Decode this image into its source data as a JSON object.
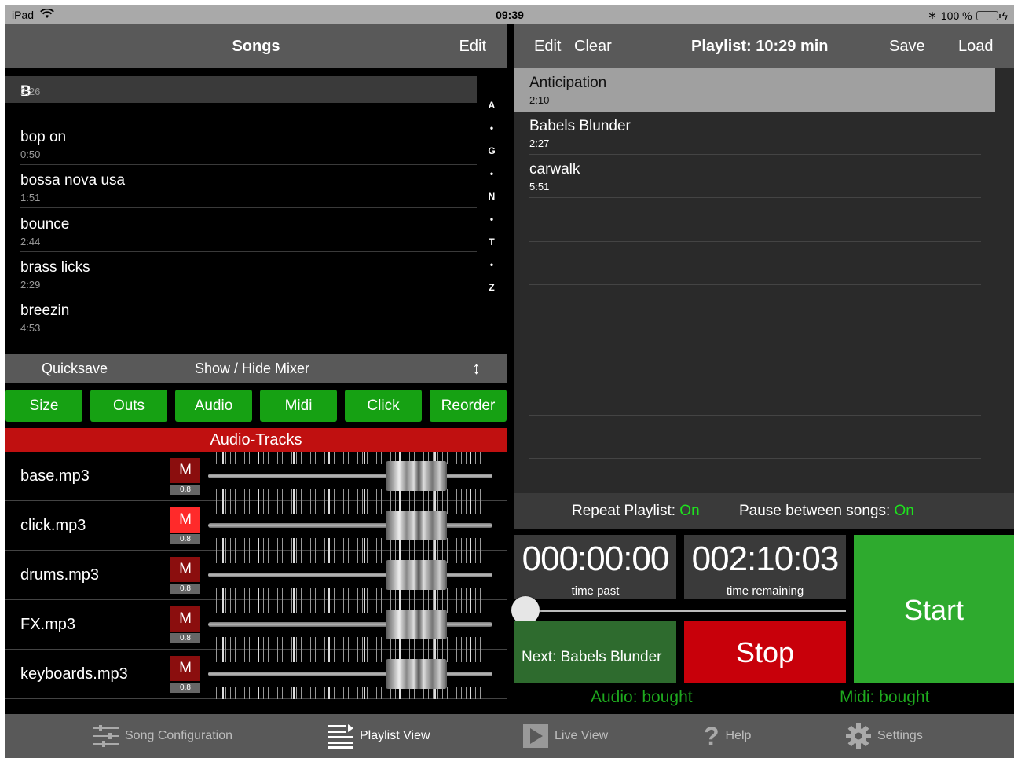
{
  "status_bar": {
    "device": "iPad",
    "time": "09:39",
    "battery": "100 %",
    "battery_level": 1.0
  },
  "songs_panel": {
    "title": "Songs",
    "edit_label": "Edit",
    "section": "B",
    "songs": [
      {
        "name": "",
        "duration": "2:26"
      },
      {
        "name": "bop on",
        "duration": "0:50"
      },
      {
        "name": "bossa nova usa",
        "duration": "1:51"
      },
      {
        "name": "bounce",
        "duration": "2:44"
      },
      {
        "name": "brass licks",
        "duration": "2:29"
      },
      {
        "name": "breezin",
        "duration": "4:53"
      }
    ],
    "index": [
      "A",
      "•",
      "G",
      "•",
      "N",
      "•",
      "T",
      "•",
      "Z"
    ]
  },
  "mixer_bar": {
    "quicksave": "Quicksave",
    "show_hide": "Show / Hide Mixer",
    "toggle_icon": "↕"
  },
  "mixer_buttons": [
    "Size",
    "Outs",
    "Audio",
    "Midi",
    "Click",
    "Reorder"
  ],
  "audio_tracks": {
    "header": "Audio-Tracks",
    "mute_label": "M",
    "tracks": [
      {
        "name": "base.mp3",
        "volume": "0.8",
        "muted": false
      },
      {
        "name": "click.mp3",
        "volume": "0.8",
        "muted": true
      },
      {
        "name": "drums.mp3",
        "volume": "0.8",
        "muted": false
      },
      {
        "name": "FX.mp3",
        "volume": "0.8",
        "muted": false
      },
      {
        "name": "keyboards.mp3",
        "volume": "0.8",
        "muted": false
      }
    ]
  },
  "playlist_panel": {
    "edit_label": "Edit",
    "clear_label": "Clear",
    "title": "Playlist:  10:29 min",
    "save_label": "Save",
    "load_label": "Load",
    "items": [
      {
        "name": "Anticipation",
        "duration": "2:10",
        "selected": true
      },
      {
        "name": "Babels Blunder",
        "duration": "2:27",
        "selected": false
      },
      {
        "name": "carwalk",
        "duration": "5:51",
        "selected": false
      }
    ]
  },
  "repeat": {
    "repeat_label": "Repeat Playlist:",
    "repeat_value": "On",
    "pause_label": "Pause between songs:",
    "pause_value": "On"
  },
  "transport": {
    "time_past": "000:00:00",
    "time_past_label": "time past",
    "time_remaining": "002:10:03",
    "time_remaining_label": "time remaining",
    "position": 0.0,
    "next_label": "Next: Babels Blunder",
    "stop_label": "Stop",
    "start_label": "Start",
    "audio_status": "Audio: bought",
    "midi_status": "Midi: bought"
  },
  "tabs": [
    {
      "label": "Song Configuration",
      "icon": "sliders-icon",
      "active": false
    },
    {
      "label": "Playlist View",
      "icon": "playlist-icon",
      "active": true
    },
    {
      "label": "Live View",
      "icon": "play-icon",
      "active": false
    },
    {
      "label": "Help",
      "icon": "question-icon",
      "active": false
    },
    {
      "label": "Settings",
      "icon": "gear-icon",
      "active": false
    }
  ],
  "colors": {
    "green_button": "#16a113",
    "red_header": "#c01010",
    "on_green": "#1ee21e",
    "stop_red": "#c8000a",
    "start_green": "#2eaa2e"
  }
}
